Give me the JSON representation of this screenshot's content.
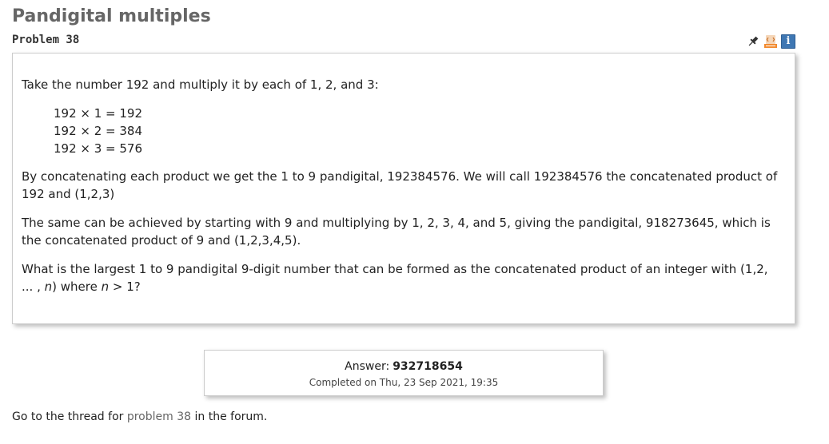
{
  "header": {
    "title": "Pandigital multiples",
    "problem_label": "Problem 38",
    "icons": [
      "pin-icon",
      "html-icon",
      "info-icon"
    ],
    "info_glyph": "i"
  },
  "problem": {
    "intro": "Take the number 192 and multiply it by each of 1, 2, and 3:",
    "calculations": [
      "192 × 1 = 192",
      "192 × 2 = 384",
      "192 × 3 = 576"
    ],
    "paragraph_concat": "By concatenating each product we get the 1 to 9 pandigital, 192384576. We will call 192384576 the concatenated product of 192 and (1,2,3)",
    "paragraph_same": "The same can be achieved by starting with 9 and multiplying by 1, 2, 3, 4, and 5, giving the pandigital, 918273645, which is the concatenated product of 9 and (1,2,3,4,5).",
    "question_part1": "What is the largest 1 to 9 pandigital 9-digit number that can be formed as the concatenated product of an integer with (1,2, ... , ",
    "question_var1": "n",
    "question_part2": ") where ",
    "question_var2": "n",
    "question_part3": " > 1?"
  },
  "answer": {
    "label": "Answer:",
    "value": "932718654",
    "completed": "Completed on Thu, 23 Sep 2021, 19:35"
  },
  "forum": {
    "prefix": "Go to the thread for ",
    "link_text": "problem 38",
    "suffix": " in the forum."
  },
  "colors": {
    "title": "#666666",
    "info_icon_bg": "#3f77b3",
    "html_icon": "#f28b30",
    "border": "#cccccc"
  }
}
